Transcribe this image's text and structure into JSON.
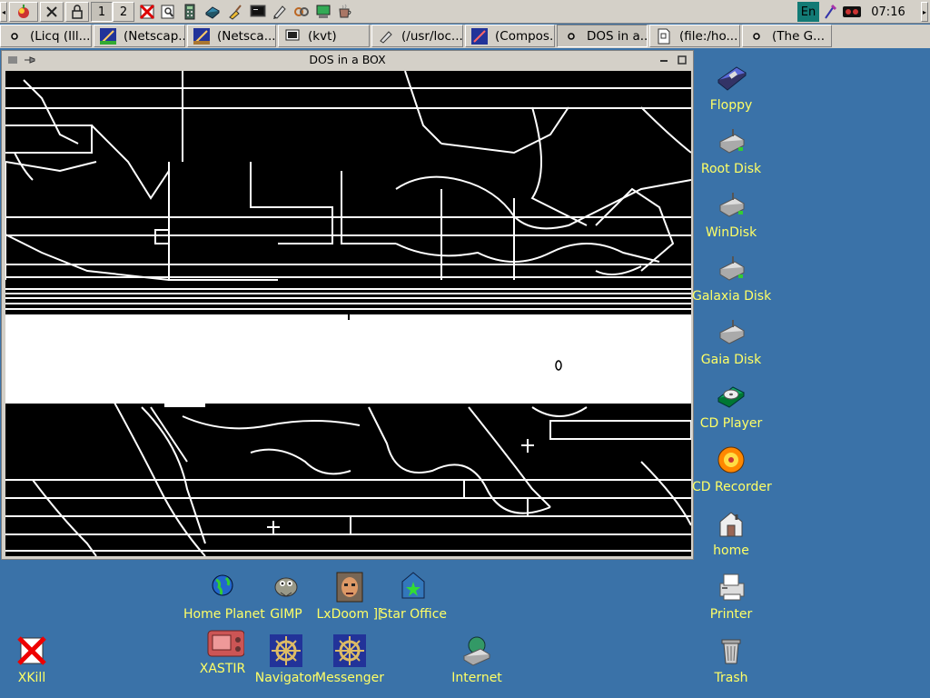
{
  "panel": {
    "desk1": "1",
    "desk2": "2",
    "launchers": [
      "menu-icon",
      "xkill-icon",
      "lock-icon",
      "close-x-icon",
      "find-icon",
      "calculator-icon",
      "disk-icon",
      "paint-icon",
      "terminal-icon",
      "edit-icon",
      "tools-icon",
      "monitor-icon",
      "cup-icon"
    ],
    "lang": "En",
    "clock": "07:16"
  },
  "tasks": [
    {
      "label": "(Licq (Ill...",
      "icon": "dot-icon"
    },
    {
      "label": "(Netscap...",
      "icon": "netscape-icon"
    },
    {
      "label": "(Netsca...",
      "icon": "netscape-icon"
    },
    {
      "label": "(kvt)",
      "icon": "terminal-icon"
    },
    {
      "label": "(/usr/loc...",
      "icon": "edit-icon"
    },
    {
      "label": "(Compos...",
      "icon": "netscape-icon"
    },
    {
      "label": "DOS in a...",
      "icon": "dot-icon"
    },
    {
      "label": "(file:/ho...",
      "icon": "file-icon"
    },
    {
      "label": "(The G...",
      "icon": "dot-icon"
    }
  ],
  "window": {
    "title": "DOS in a BOX"
  },
  "desktop_right": [
    {
      "label": "Floppy",
      "icon": "floppy-icon"
    },
    {
      "label": "Root Disk",
      "icon": "harddisk-icon"
    },
    {
      "label": "WinDisk",
      "icon": "harddisk-icon"
    },
    {
      "label": "Galaxia Disk",
      "icon": "harddisk-icon"
    },
    {
      "label": "Gaia Disk",
      "icon": "harddisk-icon"
    },
    {
      "label": "CD Player",
      "icon": "cd-player-icon"
    },
    {
      "label": "CD Recorder",
      "icon": "cd-recorder-icon"
    },
    {
      "label": "home",
      "icon": "home-icon"
    },
    {
      "label": "Printer",
      "icon": "printer-icon"
    },
    {
      "label": "Trash",
      "icon": "trash-icon"
    }
  ],
  "desktop_bottom": [
    {
      "label": "Home Planet",
      "icon": "globe-icon"
    },
    {
      "label": "GIMP",
      "icon": "gimp-icon"
    },
    {
      "label": "LxDoom ][",
      "icon": "doom-icon"
    },
    {
      "label": "Star Office",
      "icon": "staroffice-icon"
    },
    {
      "label": "XKill",
      "icon": "xkill-icon"
    },
    {
      "label": "XASTIR",
      "icon": "radio-icon"
    },
    {
      "label": "Navigator",
      "icon": "navigator-icon"
    },
    {
      "label": "Messenger",
      "icon": "messenger-icon"
    },
    {
      "label": "Internet",
      "icon": "internet-icon"
    }
  ]
}
